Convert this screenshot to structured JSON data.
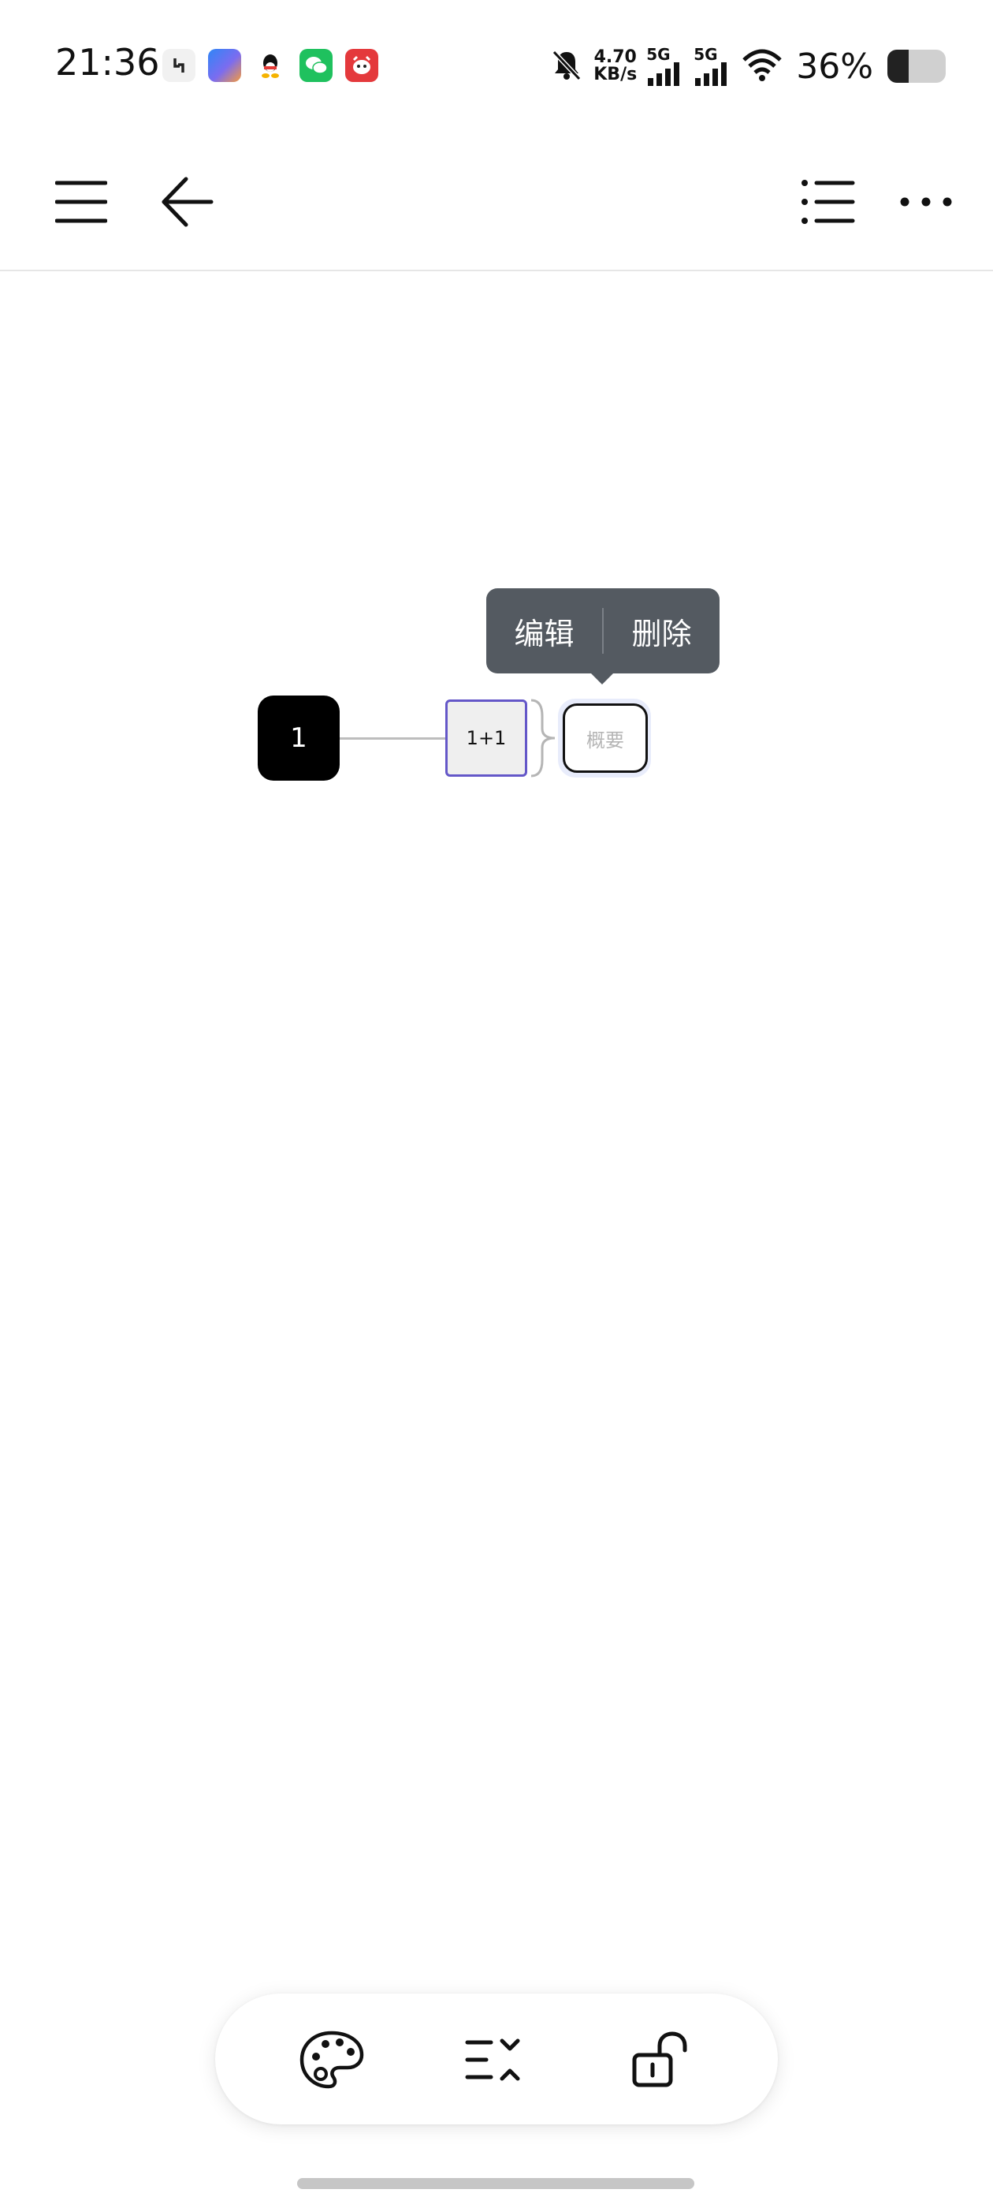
{
  "status_bar": {
    "time": "21:36",
    "net_speed_value": "4.70",
    "net_speed_unit": "KB/s",
    "sim1_label": "5G",
    "sim2_label": "5G",
    "battery_percent": "36%",
    "battery_level": 0.36,
    "notification_icons": [
      "app-icon",
      "browser-icon",
      "qq-icon",
      "wechat-icon",
      "jd-icon"
    ]
  },
  "toolbar": {
    "left_icons": [
      "menu-icon",
      "back-arrow-icon"
    ],
    "right_icons": [
      "outline-list-icon",
      "more-options-icon"
    ]
  },
  "mindmap": {
    "root_label": "1",
    "child_label": "1+1",
    "summary_placeholder": "概要"
  },
  "context_menu": {
    "edit_label": "编辑",
    "delete_label": "删除"
  },
  "dock": {
    "icons": [
      "palette-icon",
      "expand-collapse-icon",
      "unlock-icon"
    ]
  },
  "colors": {
    "root_node": "#000000",
    "child_border": "#6457c8",
    "popup_bg": "#545a61"
  }
}
